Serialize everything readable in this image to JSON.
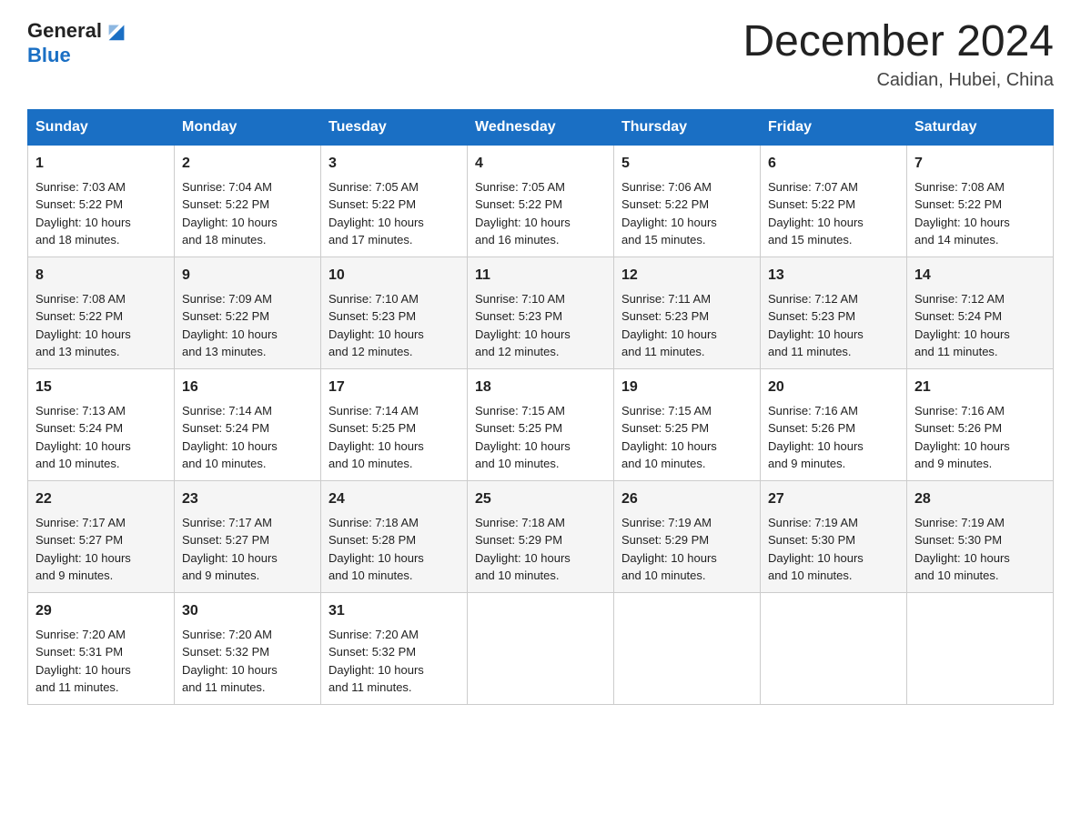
{
  "logo": {
    "text_general": "General",
    "text_blue": "Blue"
  },
  "header": {
    "month": "December 2024",
    "location": "Caidian, Hubei, China"
  },
  "days_of_week": [
    "Sunday",
    "Monday",
    "Tuesday",
    "Wednesday",
    "Thursday",
    "Friday",
    "Saturday"
  ],
  "weeks": [
    [
      {
        "day": "1",
        "sunrise": "7:03 AM",
        "sunset": "5:22 PM",
        "daylight": "10 hours and 18 minutes."
      },
      {
        "day": "2",
        "sunrise": "7:04 AM",
        "sunset": "5:22 PM",
        "daylight": "10 hours and 18 minutes."
      },
      {
        "day": "3",
        "sunrise": "7:05 AM",
        "sunset": "5:22 PM",
        "daylight": "10 hours and 17 minutes."
      },
      {
        "day": "4",
        "sunrise": "7:05 AM",
        "sunset": "5:22 PM",
        "daylight": "10 hours and 16 minutes."
      },
      {
        "day": "5",
        "sunrise": "7:06 AM",
        "sunset": "5:22 PM",
        "daylight": "10 hours and 15 minutes."
      },
      {
        "day": "6",
        "sunrise": "7:07 AM",
        "sunset": "5:22 PM",
        "daylight": "10 hours and 15 minutes."
      },
      {
        "day": "7",
        "sunrise": "7:08 AM",
        "sunset": "5:22 PM",
        "daylight": "10 hours and 14 minutes."
      }
    ],
    [
      {
        "day": "8",
        "sunrise": "7:08 AM",
        "sunset": "5:22 PM",
        "daylight": "10 hours and 13 minutes."
      },
      {
        "day": "9",
        "sunrise": "7:09 AM",
        "sunset": "5:22 PM",
        "daylight": "10 hours and 13 minutes."
      },
      {
        "day": "10",
        "sunrise": "7:10 AM",
        "sunset": "5:23 PM",
        "daylight": "10 hours and 12 minutes."
      },
      {
        "day": "11",
        "sunrise": "7:10 AM",
        "sunset": "5:23 PM",
        "daylight": "10 hours and 12 minutes."
      },
      {
        "day": "12",
        "sunrise": "7:11 AM",
        "sunset": "5:23 PM",
        "daylight": "10 hours and 11 minutes."
      },
      {
        "day": "13",
        "sunrise": "7:12 AM",
        "sunset": "5:23 PM",
        "daylight": "10 hours and 11 minutes."
      },
      {
        "day": "14",
        "sunrise": "7:12 AM",
        "sunset": "5:24 PM",
        "daylight": "10 hours and 11 minutes."
      }
    ],
    [
      {
        "day": "15",
        "sunrise": "7:13 AM",
        "sunset": "5:24 PM",
        "daylight": "10 hours and 10 minutes."
      },
      {
        "day": "16",
        "sunrise": "7:14 AM",
        "sunset": "5:24 PM",
        "daylight": "10 hours and 10 minutes."
      },
      {
        "day": "17",
        "sunrise": "7:14 AM",
        "sunset": "5:25 PM",
        "daylight": "10 hours and 10 minutes."
      },
      {
        "day": "18",
        "sunrise": "7:15 AM",
        "sunset": "5:25 PM",
        "daylight": "10 hours and 10 minutes."
      },
      {
        "day": "19",
        "sunrise": "7:15 AM",
        "sunset": "5:25 PM",
        "daylight": "10 hours and 10 minutes."
      },
      {
        "day": "20",
        "sunrise": "7:16 AM",
        "sunset": "5:26 PM",
        "daylight": "10 hours and 9 minutes."
      },
      {
        "day": "21",
        "sunrise": "7:16 AM",
        "sunset": "5:26 PM",
        "daylight": "10 hours and 9 minutes."
      }
    ],
    [
      {
        "day": "22",
        "sunrise": "7:17 AM",
        "sunset": "5:27 PM",
        "daylight": "10 hours and 9 minutes."
      },
      {
        "day": "23",
        "sunrise": "7:17 AM",
        "sunset": "5:27 PM",
        "daylight": "10 hours and 9 minutes."
      },
      {
        "day": "24",
        "sunrise": "7:18 AM",
        "sunset": "5:28 PM",
        "daylight": "10 hours and 10 minutes."
      },
      {
        "day": "25",
        "sunrise": "7:18 AM",
        "sunset": "5:29 PM",
        "daylight": "10 hours and 10 minutes."
      },
      {
        "day": "26",
        "sunrise": "7:19 AM",
        "sunset": "5:29 PM",
        "daylight": "10 hours and 10 minutes."
      },
      {
        "day": "27",
        "sunrise": "7:19 AM",
        "sunset": "5:30 PM",
        "daylight": "10 hours and 10 minutes."
      },
      {
        "day": "28",
        "sunrise": "7:19 AM",
        "sunset": "5:30 PM",
        "daylight": "10 hours and 10 minutes."
      }
    ],
    [
      {
        "day": "29",
        "sunrise": "7:20 AM",
        "sunset": "5:31 PM",
        "daylight": "10 hours and 11 minutes."
      },
      {
        "day": "30",
        "sunrise": "7:20 AM",
        "sunset": "5:32 PM",
        "daylight": "10 hours and 11 minutes."
      },
      {
        "day": "31",
        "sunrise": "7:20 AM",
        "sunset": "5:32 PM",
        "daylight": "10 hours and 11 minutes."
      },
      null,
      null,
      null,
      null
    ]
  ],
  "labels": {
    "sunrise": "Sunrise:",
    "sunset": "Sunset:",
    "daylight": "Daylight:"
  }
}
